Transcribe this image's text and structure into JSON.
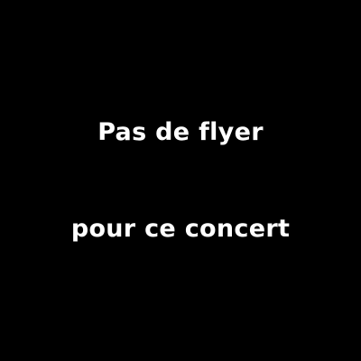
{
  "message": {
    "line1": "Pas de flyer",
    "line2": "pour ce concert"
  },
  "colors": {
    "background": "#000000",
    "text": "#ffffff"
  }
}
